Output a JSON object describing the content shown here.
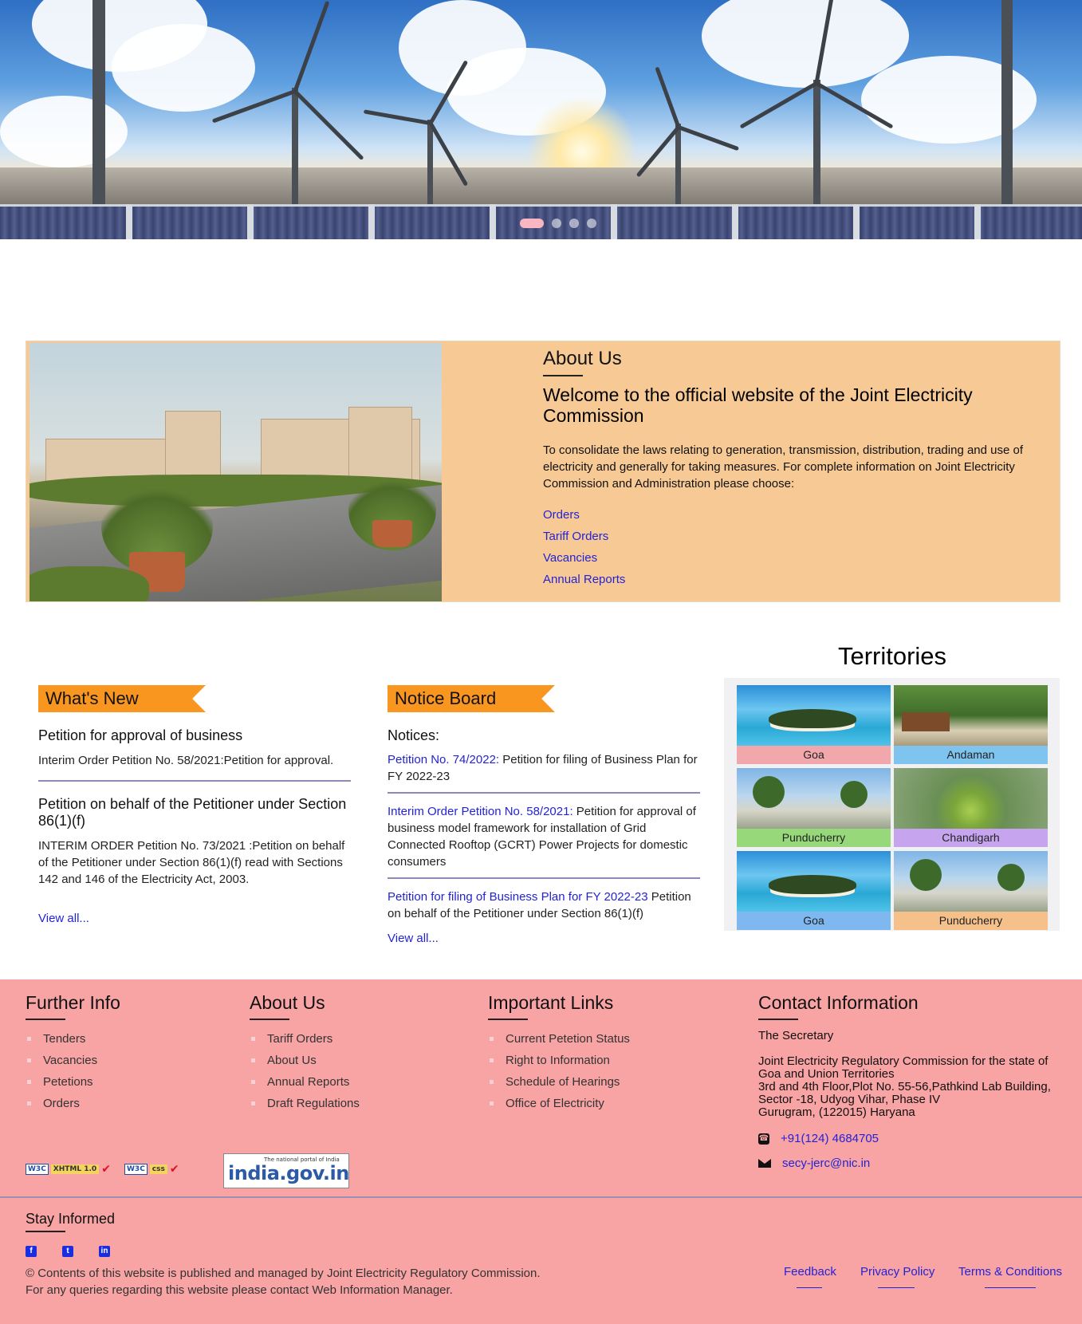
{
  "hero": {
    "slide_count": 4,
    "active_slide": 1
  },
  "about": {
    "heading": "About Us",
    "title": "Welcome to the official website of the Joint Electricity Commission",
    "description": "To consolidate the laws relating to generation, transmission, distribution, trading and use of electricity and generally for taking measures. For complete information on Joint Electricity Commission and Administration please choose:",
    "links": [
      "Orders",
      "Tariff Orders",
      "Vacancies",
      "Annual Reports"
    ]
  },
  "whats_new": {
    "heading": "What's New",
    "items": [
      {
        "title": "Petition for approval of business",
        "text": "Interim Order Petition No. 58/2021:Petition for approval."
      },
      {
        "title": "Petition on behalf of the Petitioner under Section 86(1)(f)",
        "text": "INTERIM ORDER Petition No. 73/2021 :Petition on behalf of the Petitioner under Section 86(1)(f) read with Sections 142 and 146 of the Electricity Act, 2003."
      }
    ],
    "view_all": "View all..."
  },
  "notice_board": {
    "heading": "Notice Board",
    "subheading": "Notices:",
    "items": [
      {
        "link": "Petition No. 74/2022:",
        "text": " Petition for filing of Business Plan for FY 2022-23"
      },
      {
        "link": "Interim Order Petition No. 58/2021:",
        "text": " Petition for approval of business model framework for installation of Grid Connected Rooftop (GCRT) Power Projects for domestic consumers"
      },
      {
        "link": "Petition for filing of Business Plan for FY 2022-23",
        "text": " Petition on behalf of the Petitioner under Section 86(1)(f)"
      }
    ],
    "view_all": "View all..."
  },
  "territories": {
    "heading": "Territories",
    "tiles": [
      {
        "name": "Goa",
        "color": "#f2a7ad"
      },
      {
        "name": "Andaman",
        "color": "#7fc4ee"
      },
      {
        "name": "Punducherry",
        "color": "#96d87a"
      },
      {
        "name": "Chandigarh",
        "color": "#c6a5ee"
      },
      {
        "name": "Goa",
        "color": "#7fb8f0"
      },
      {
        "name": "Punducherry",
        "color": "#f5c08a"
      }
    ]
  },
  "footer": {
    "further_info": {
      "heading": "Further Info",
      "items": [
        "Tenders",
        "Vacancies",
        "Petetions",
        "Orders"
      ]
    },
    "about_us": {
      "heading": "About Us",
      "items": [
        "Tariff Orders",
        "About Us",
        "Annual Reports",
        "Draft Regulations"
      ]
    },
    "important_links": {
      "heading": "Important Links",
      "items": [
        "Current Petetion Status",
        "Right to Information",
        "Schedule of Hearings",
        "Office of Electricity"
      ]
    },
    "contact": {
      "heading": "Contact Information",
      "name": "The Secretary",
      "address_lines": [
        "Joint Electricity Regulatory Commission for the state of",
        "Goa and Union Territories",
        "3rd and 4th Floor,Plot No. 55-56,Pathkind Lab Building,",
        "Sector -18, Udyog Vihar, Phase IV",
        "Gurugram, (122015) Haryana"
      ],
      "phone": "+91(124) 4684705",
      "email": "secy-jerc@nic.in"
    },
    "badges": {
      "w3c": "W3C",
      "xhtml": "XHTML 1.0",
      "css": "css",
      "india_small": "The national portal of India",
      "india_big": "india.gov.in"
    },
    "stay_informed": "Stay Informed",
    "social": [
      "f",
      "t",
      "in"
    ],
    "copyright_1": "© Contents of this website is published and managed by Joint Electricity Regulatory Commission.",
    "copyright_2": "For any queries regarding this website please contact Web Information Manager.",
    "bottom_links": [
      "Feedback",
      "Privacy Policy",
      "Terms & Conditions"
    ]
  }
}
